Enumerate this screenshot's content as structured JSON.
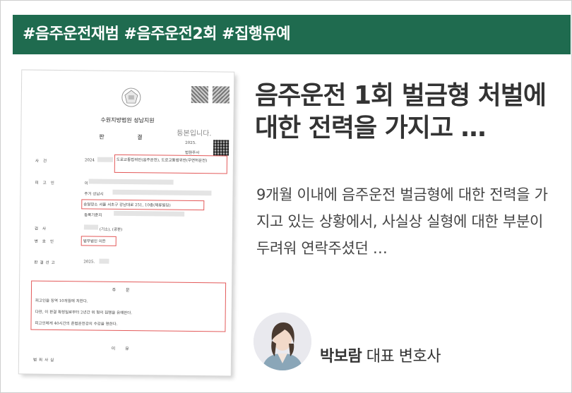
{
  "banner": {
    "tags": "#음주운전재범 #음주운전2회 #집행유예"
  },
  "document": {
    "court": "수원지방법원 성남지원",
    "title": "판 결",
    "stamp": "등본입니다.",
    "year_small": "2025.",
    "clerk": "법원주사",
    "labels": {
      "case": "사건",
      "defendant": "피고인",
      "prosecutor": "검사",
      "lawyer": "변호인",
      "sentence_date": "판결선고",
      "order": "주문",
      "reason": "이유",
      "crime_facts": "범죄사실"
    },
    "case_year": "2024",
    "case_name": "도로교통법위반(음주운전), 도로교통법위반(무면허운전)",
    "defendant_name": "이",
    "address_label": "주거 성남시",
    "registered_address": "등록기준지",
    "workplace": "송달장소 서울 서초구 강남대로 251, 10층(체류빌딩)",
    "prosecutor_note": "(기소), (공판)",
    "lawyer_name": "법무법인 이든",
    "sentence_year": "2025.",
    "order_lines": [
      "피고인을 징역 10개월에 처한다.",
      "다만, 이 판결 확정일로부터 2년간 위 형의 집행을 유예한다.",
      "피고인에게 40시간의 준법운전강의 수강을 명한다."
    ]
  },
  "article": {
    "headline": "음주운전 1회 벌금형 처벌에 대한 전력을 가지고 …",
    "summary": "9개월 이내에 음주운전 벌금형에 대한 전력을 가지고 있는 상황에서, 사실상 실형에 대한 부분이 두려워 연락주셨던 …"
  },
  "author": {
    "name": "박보람",
    "title": "대표 변호사"
  },
  "colors": {
    "banner": "#1f6b4f",
    "highlight": "#e35a5a"
  }
}
